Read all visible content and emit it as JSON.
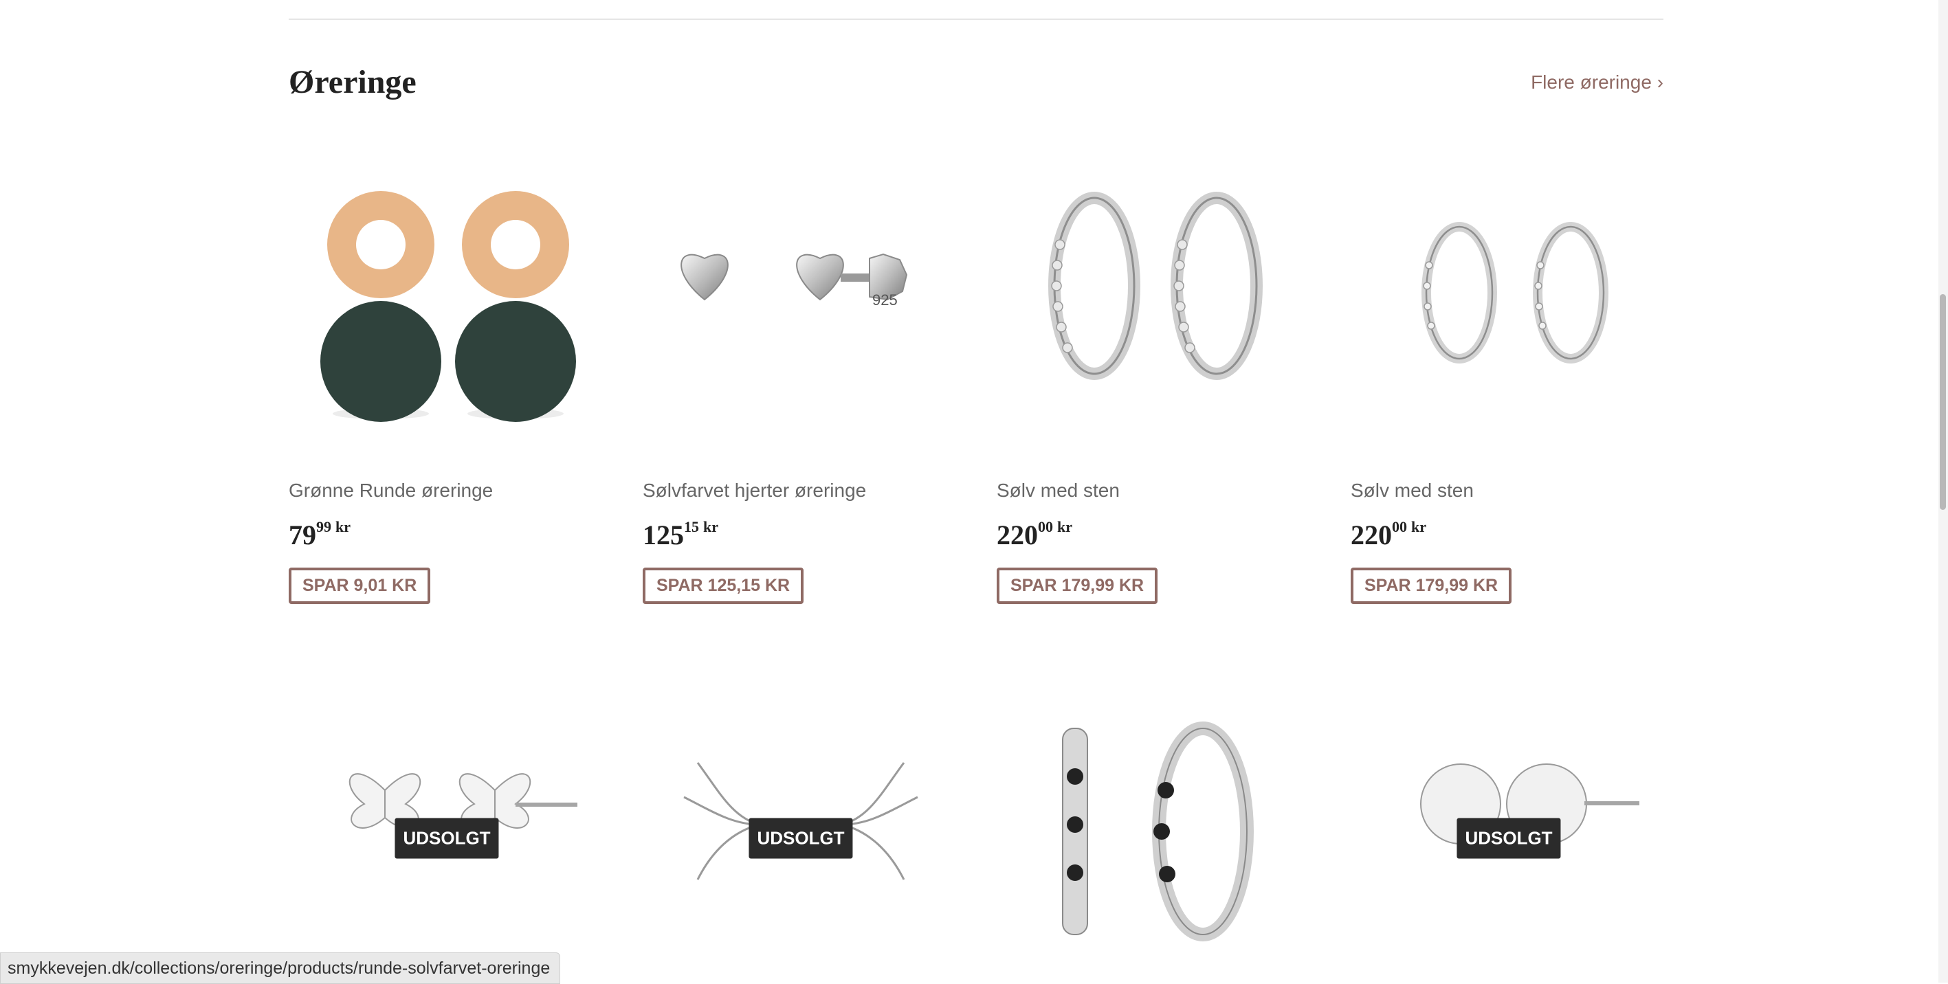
{
  "section": {
    "title": "Øreringe",
    "more_link": "Flere øreringe ›"
  },
  "products_row1": [
    {
      "name": "Grønne Runde øreringe",
      "price_main": "79",
      "price_cents": "99",
      "currency": "kr",
      "save": "SPAR 9,01 KR",
      "image_icon": "green-round-earrings-image"
    },
    {
      "name": "Sølvfarvet hjerter øreringe",
      "price_main": "125",
      "price_cents": "15",
      "currency": "kr",
      "save": "SPAR 125,15 KR",
      "image_icon": "silver-heart-earrings-image"
    },
    {
      "name": "Sølv med sten",
      "price_main": "220",
      "price_cents": "00",
      "currency": "kr",
      "save": "SPAR 179,99 KR",
      "image_icon": "silver-stone-hoops-image"
    },
    {
      "name": "Sølv med sten",
      "price_main": "220",
      "price_cents": "00",
      "currency": "kr",
      "save": "SPAR 179,99 KR",
      "image_icon": "silver-small-hoops-image"
    }
  ],
  "products_row2": [
    {
      "badge": "UDSOLGT",
      "image_icon": "butterfly-earrings-image"
    },
    {
      "badge": "UDSOLGT",
      "image_icon": "swallow-earrings-image"
    },
    {
      "badge": "",
      "image_icon": "heart-black-stone-hoops-image"
    },
    {
      "badge": "UDSOLGT",
      "image_icon": "round-disc-earrings-image"
    }
  ],
  "status_bar": {
    "url": "smykkevejen.dk/collections/oreringe/products/runde-solvfarvet-oreringe"
  },
  "colors": {
    "accent": "#8f6a64",
    "soldout_bg": "#2b2b2b",
    "gold": "#e8b688",
    "dark_green": "#2f423c"
  }
}
